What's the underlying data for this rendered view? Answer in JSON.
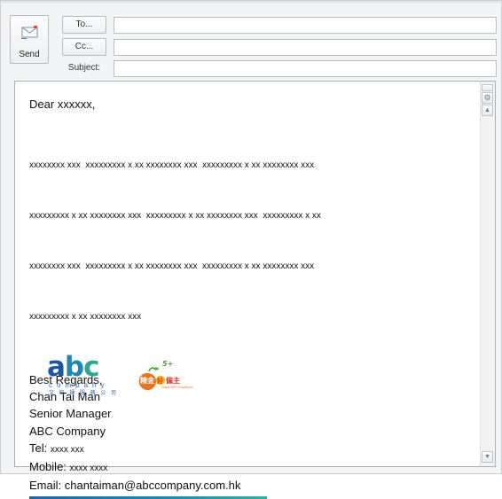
{
  "header": {
    "send_label": "Send",
    "to_label": "To...",
    "cc_label": "Cc...",
    "subject_label": "Subject:",
    "to_value": "",
    "cc_value": "",
    "subject_value": ""
  },
  "body": {
    "greeting": "Dear xxxxxx,",
    "paragraph_lines": [
      "xxxxxxxx xxx  xxxxxxxxx x xx xxxxxxxx xxx  xxxxxxxxx x xx xxxxxxxx xxx",
      "xxxxxxxxx x xx xxxxxxxx xxx  xxxxxxxxx x xx xxxxxxxx xxx  xxxxxxxxx x xx",
      "xxxxxxxx xxx  xxxxxxxxx x xx xxxxxxxx xxx  xxxxxxxxx x xx xxxxxxxx xxx",
      "xxxxxxxxx x xx xxxxxxxx xxx"
    ],
    "signature": {
      "closing": "Best Regards,",
      "name": "Chan Tai Man",
      "title": "Senior Manager",
      "company": "ABC Company",
      "tel_label": "Tel: ",
      "tel_value": "xxxx xxx",
      "mobile_label": "Mobile: ",
      "mobile_value": "xxxx xxxx",
      "email_label": "Email: ",
      "email_value": "chantaiman@abccompany.com.hk"
    },
    "logo_abc": {
      "word_a": "a",
      "word_b": "b",
      "word_c": "c",
      "company": "company",
      "chinese": "文 柏 師 服 務 公 司"
    },
    "logo_employer": {
      "main": "精金",
      "badge": "好",
      "suffix": "僱主",
      "number": "5+",
      "caption": "Good MPF Employer"
    }
  },
  "colors": {
    "abc_blue": "#1d55a6",
    "abc_teal": "#2ca796",
    "employer_orange": "#e8731d",
    "employer_red": "#d8332a"
  },
  "icons": [
    "send-envelope-icon",
    "split-handle-icon",
    "tools-icon",
    "scroll-up-icon",
    "scroll-down-icon"
  ]
}
